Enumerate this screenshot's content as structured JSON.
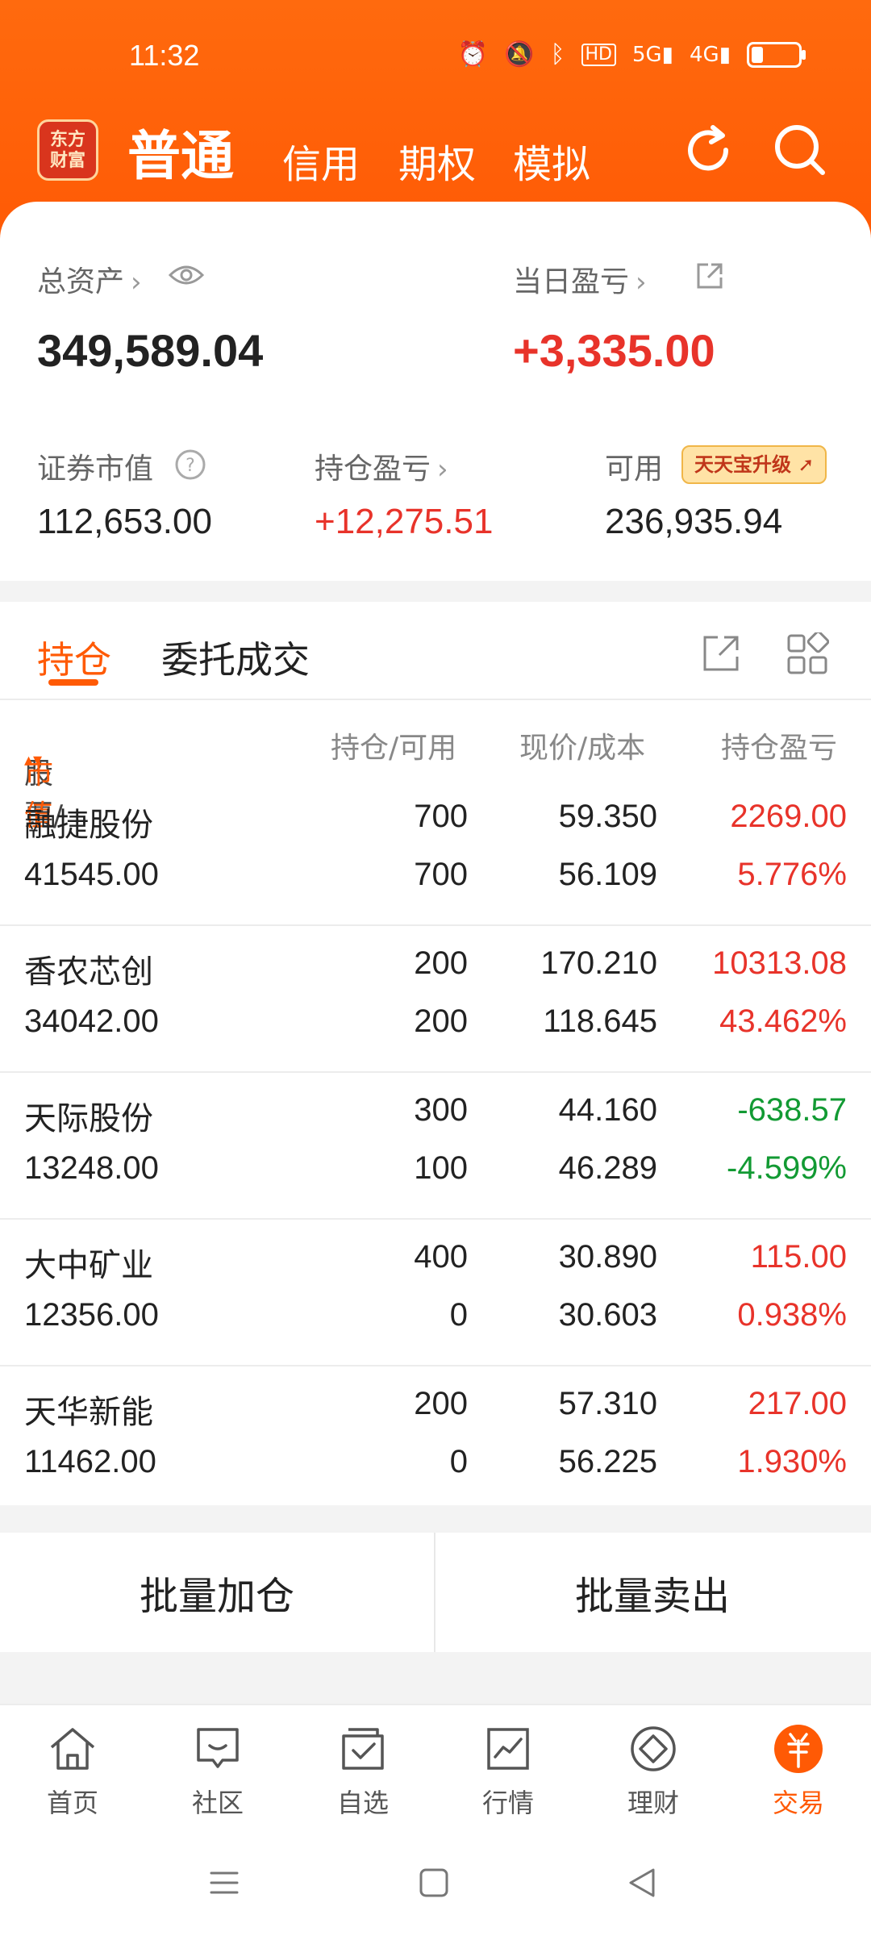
{
  "status": {
    "time": "11:32",
    "network": "4G"
  },
  "topnav": {
    "logo": "东方财富",
    "main_tab": "普通",
    "tabs": [
      "信用",
      "期权",
      "模拟"
    ]
  },
  "summary": {
    "total_assets_label": "总资产",
    "total_assets": "349,589.04",
    "daily_pnl_label": "当日盈亏",
    "daily_pnl": "+3,335.00",
    "market_value_label": "证券市值",
    "market_value": "112,653.00",
    "position_pnl_label": "持仓盈亏",
    "position_pnl": "+12,275.51",
    "available_label": "可用",
    "available_badge": "天天宝升级",
    "available": "236,935.94"
  },
  "panel": {
    "tab_positions": "持仓",
    "tab_orders": "委托成交",
    "headers": {
      "stock": "股票/",
      "value": "市值",
      "position": "持仓/可用",
      "price": "现价/成本",
      "pnl": "持仓盈亏"
    },
    "rows": [
      {
        "name": "融捷股份",
        "value": "41545.00",
        "hold": "700",
        "avail": "700",
        "price": "59.350",
        "cost": "56.109",
        "pnl": "2269.00",
        "pct": "5.776%",
        "dir": "up"
      },
      {
        "name": "香农芯创",
        "value": "34042.00",
        "hold": "200",
        "avail": "200",
        "price": "170.210",
        "cost": "118.645",
        "pnl": "10313.08",
        "pct": "43.462%",
        "dir": "up"
      },
      {
        "name": "天际股份",
        "value": "13248.00",
        "hold": "300",
        "avail": "100",
        "price": "44.160",
        "cost": "46.289",
        "pnl": "-638.57",
        "pct": "-4.599%",
        "dir": "down"
      },
      {
        "name": "大中矿业",
        "value": "12356.00",
        "hold": "400",
        "avail": "0",
        "price": "30.890",
        "cost": "30.603",
        "pnl": "115.00",
        "pct": "0.938%",
        "dir": "up"
      },
      {
        "name": "天华新能",
        "value": "11462.00",
        "hold": "200",
        "avail": "0",
        "price": "57.310",
        "cost": "56.225",
        "pnl": "217.00",
        "pct": "1.930%",
        "dir": "up"
      }
    ]
  },
  "actions": {
    "batch_add": "批量加仓",
    "batch_sell": "批量卖出"
  },
  "bottom_nav": [
    "首页",
    "社区",
    "自选",
    "行情",
    "理财",
    "交易"
  ],
  "colors": {
    "accent": "#ff5a05",
    "up": "#e8332a",
    "down": "#129a33"
  }
}
